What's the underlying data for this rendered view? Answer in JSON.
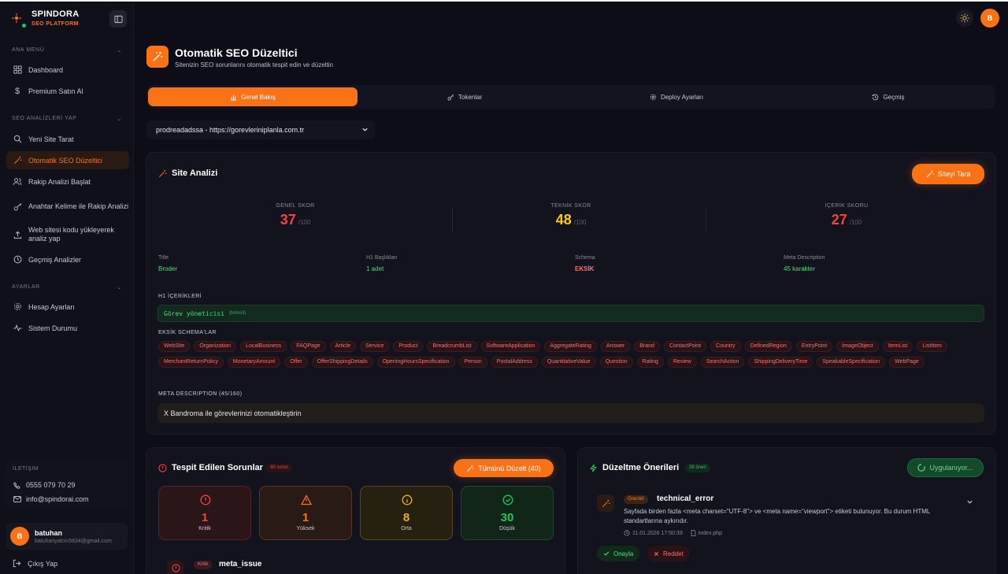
{
  "brand": {
    "name": "SPINDORA",
    "sub": "SEO PLATFORM"
  },
  "sidebar": {
    "sections": [
      {
        "title": "ANA MENÜ",
        "items": [
          {
            "label": "Dashboard",
            "icon": "grid-icon"
          },
          {
            "label": "Premium Satın Al",
            "icon": "dollar-icon"
          }
        ]
      },
      {
        "title": "SEO ANALİZLERİ YAP",
        "items": [
          {
            "label": "Yeni Site Tarat",
            "icon": "search-icon"
          },
          {
            "label": "Otomatik SEO Düzeltici",
            "icon": "wand-icon",
            "active": true
          },
          {
            "label": "Rakip Analizi Başlat",
            "icon": "users-icon"
          },
          {
            "label": "Anahtar Kelime ile Rakip Analizi",
            "icon": "key-icon"
          },
          {
            "label": "Web sitesi kodu yükleyerek analiz yap",
            "icon": "upload-icon"
          },
          {
            "label": "Geçmiş Analizler",
            "icon": "clock-icon"
          }
        ]
      },
      {
        "title": "AYARLAR",
        "items": [
          {
            "label": "Hesap Ayarları",
            "icon": "gear-icon"
          },
          {
            "label": "Sistem Durumu",
            "icon": "activity-icon"
          }
        ]
      }
    ],
    "contact": {
      "title": "İLETİŞİM",
      "phone": "0555 079 70 29",
      "email": "info@spindorai.com"
    },
    "user": {
      "initial": "B",
      "name": "batuhan",
      "email": "batuhanyalcin5834@gmail.com"
    },
    "logout": "Çıkış Yap"
  },
  "topbar": {
    "avatar": "B"
  },
  "page": {
    "title": "Otomatik SEO Düzeltici",
    "subtitle": "Sitenizin SEO sorunlarını otomatik tespit edin ve düzeltin"
  },
  "tabs": [
    {
      "label": "Genel Bakış",
      "icon": "bar-chart-icon",
      "active": true
    },
    {
      "label": "Tokenlar",
      "icon": "key-icon"
    },
    {
      "label": "Deploy Ayarları",
      "icon": "gear-icon"
    },
    {
      "label": "Geçmiş",
      "icon": "history-icon"
    }
  ],
  "site_select": {
    "value": "prodreadadssa - https://gorevleriniplanla.com.tr"
  },
  "analysis": {
    "title": "Site Analizi",
    "scan_button": "Siteyi Tara",
    "scores": [
      {
        "label": "GENEL SKOR",
        "value": "37",
        "max": "/100",
        "color": "#ef4444"
      },
      {
        "label": "TEKNİK SKOR",
        "value": "48",
        "max": "/100",
        "color": "#facc15"
      },
      {
        "label": "İÇERİK SKORU",
        "value": "27",
        "max": "/100",
        "color": "#ef4444"
      }
    ],
    "meta": [
      {
        "key": "Title",
        "value": "Broder",
        "status": "green"
      },
      {
        "key": "H1 Başlıkları",
        "value": "1 adet",
        "status": "green"
      },
      {
        "key": "Schema",
        "value": "EKSİK",
        "status": "red"
      },
      {
        "key": "Meta Description",
        "value": "45 karakter",
        "status": "green"
      }
    ],
    "h1_title": "H1 İÇERİKLERİ",
    "h1_value": "Görev yöneticisi",
    "h1_note": "(birincil)",
    "schema_title": "EKSİK SCHEMA'LAR",
    "schemas": [
      "WebSite",
      "Organization",
      "LocalBusiness",
      "FAQPage",
      "Article",
      "Service",
      "Product",
      "BreadcrumbList",
      "SoftwareApplication",
      "AggregateRating",
      "Answer",
      "Brand",
      "ContactPoint",
      "Country",
      "DefinedRegion",
      "EntryPoint",
      "ImageObject",
      "ItemList",
      "ListItem",
      "MerchantReturnPolicy",
      "MonetaryAmount",
      "Offer",
      "OfferShippingDetails",
      "OpeningHoursSpecification",
      "Person",
      "PostalAddress",
      "QuantitativeValue",
      "Question",
      "Rating",
      "Review",
      "SearchAction",
      "ShippingDeliveryTime",
      "SpeakableSpecification",
      "WebPage"
    ],
    "meta_desc_title": "META DESCRIPTION (45/160)",
    "meta_desc_value": "X Bandroma ile görevlerinizi otomatikleştirin"
  },
  "issues": {
    "title": "Tespit Edilen Sorunlar",
    "count": "40 sorun",
    "fix_all": "Tümünü Düzelt (40)",
    "severity": [
      {
        "num": "1",
        "label": "Kritik",
        "color": "#ef4444"
      },
      {
        "num": "1",
        "label": "Yüksek",
        "color": "#f97316"
      },
      {
        "num": "8",
        "label": "Orta",
        "color": "#eab308"
      },
      {
        "num": "30",
        "label": "Düşük",
        "color": "#22c55e"
      }
    ],
    "first": {
      "badge": "Kritik",
      "type": "meta_issue"
    }
  },
  "suggestions": {
    "title": "Düzeltme Önerileri",
    "count": "38 öneri",
    "applying": "Uygulanıyor...",
    "item": {
      "badge": "Önerildi",
      "type": "technical_error",
      "text": "Sayfada birden fazla <meta charset=\"UTF-8\"> ve <meta name=\"viewport\"> etiketi bulunuyor. Bu durum HTML standartlarına aykırıdır.",
      "date": "11.01.2026 17:50:39",
      "file": "index.php",
      "approve": "Onayla",
      "reject": "Reddet"
    }
  },
  "colors": {
    "accent": "#f97316",
    "danger": "#ef4444",
    "success": "#22c55e",
    "warning": "#eab308"
  }
}
